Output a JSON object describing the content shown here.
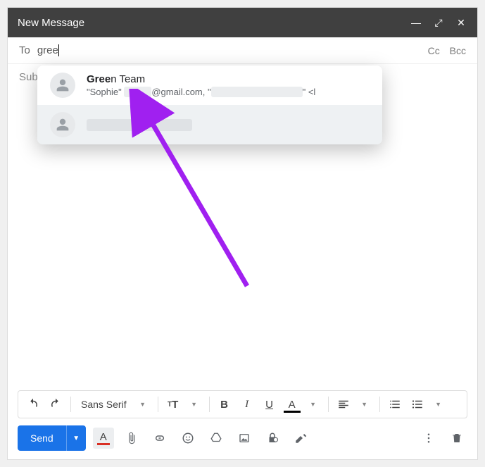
{
  "window": {
    "title": "New Message"
  },
  "to": {
    "label": "To",
    "value": "gree",
    "cc": "Cc",
    "bcc": "Bcc"
  },
  "subject": {
    "label": "Subject"
  },
  "suggestions": {
    "item0": {
      "name_bold": "Gree",
      "name_rest": "n Team",
      "mail_prefix": "\"Sophie\" ",
      "mail_mid": "@gmail.com, \"",
      "mail_suffix": "\" <l"
    }
  },
  "toolbar": {
    "font": "Sans Serif"
  },
  "send": {
    "label": "Send"
  }
}
